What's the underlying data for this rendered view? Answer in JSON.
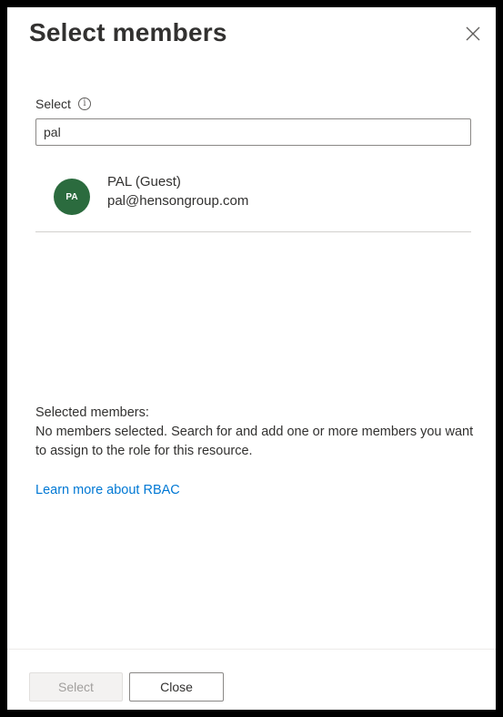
{
  "panel": {
    "title": "Select members",
    "close_icon": "close-icon"
  },
  "search": {
    "label": "Select",
    "info_icon": "info-icon",
    "info_glyph": "i",
    "value": "pal"
  },
  "results": [
    {
      "initials": "PA",
      "avatar_color": "#2b6b3e",
      "name": "PAL (Guest)",
      "email": "pal@hensongroup.com"
    }
  ],
  "selected": {
    "heading": "Selected members:",
    "empty_message": "No members selected. Search for and add one or more members you want to assign to the role for this resource."
  },
  "learn_more": {
    "label": "Learn more about RBAC",
    "color": "#0078d4"
  },
  "footer": {
    "select_label": "Select",
    "close_label": "Close"
  }
}
